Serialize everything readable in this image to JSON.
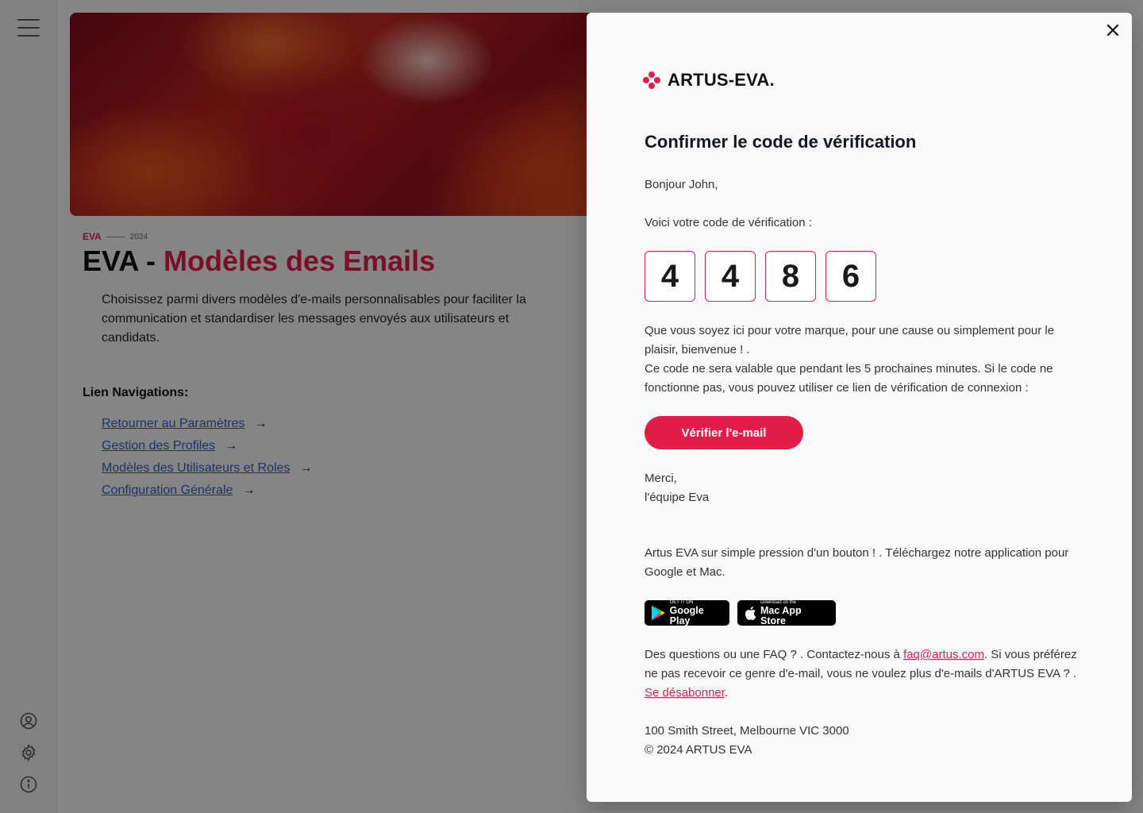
{
  "sidebar": {
    "menu_icon": "hamburger-menu-icon",
    "bottom_icons": [
      "user-circle-icon",
      "gear-icon",
      "info-icon"
    ]
  },
  "page": {
    "eyebrow_brand": "EVA",
    "eyebrow_year": "2024",
    "title_prefix": "EVA - ",
    "title_accent": "Modèles des Emails",
    "description": "Choisissez parmi divers modèles d'e-mails personnalisables pour faciliter la communication et standardiser les messages envoyés aux utilisateurs et candidats.",
    "nav_heading": "Lien Navigations:",
    "nav_links": [
      {
        "label": "Retourner au Paramètres",
        "arrow": "→"
      },
      {
        "label": "Gestion des Profiles",
        "arrow": "→"
      },
      {
        "label": "Modèles des Utilisateurs et Roles",
        "arrow": "→"
      },
      {
        "label": "Configuration Générale",
        "arrow": "→"
      }
    ]
  },
  "modal": {
    "logo_text": "ARTUS-EVA.",
    "title": "Confirmer le code de vérification",
    "greeting": "Bonjour John,",
    "code_intro": "Voici votre code de vérification :",
    "code_digits": [
      "4",
      "4",
      "8",
      "6"
    ],
    "body_line1": "Que vous soyez ici pour votre marque, pour une cause ou simplement pour le plaisir, bienvenue ! .",
    "body_line2": "Ce code ne sera valable que pendant les 5 prochaines minutes. Si le code ne fonctionne pas, vous pouvez utiliser ce lien de vérification de connexion :",
    "verify_button": "Vérifier l'e-mail",
    "thanks": "Merci,",
    "signature": "l'équipe Eva",
    "app_promo": "Artus EVA sur simple pression d'un bouton ! . Téléchargez notre application pour Google et Mac.",
    "google_play": {
      "small": "GET IT ON",
      "big": "Google Play"
    },
    "mac_store": {
      "small": "Download on the",
      "big": "Mac App Store"
    },
    "faq_prefix": "Des questions ou une FAQ ? . Contactez-nous à ",
    "faq_email": "faq@artus.com",
    "faq_middle": ". Si vous préférez ne pas recevoir ce genre d'e-mail, vous ne voulez plus d'e-mails d'ARTUS EVA ? . ",
    "unsubscribe": "Se désabonner",
    "faq_suffix": ".",
    "address": "100 Smith Street, Melbourne VIC 3000",
    "copyright": "© 2024 ARTUS EVA"
  },
  "colors": {
    "accent": "#e11d48",
    "link": "#2d5bd0"
  }
}
